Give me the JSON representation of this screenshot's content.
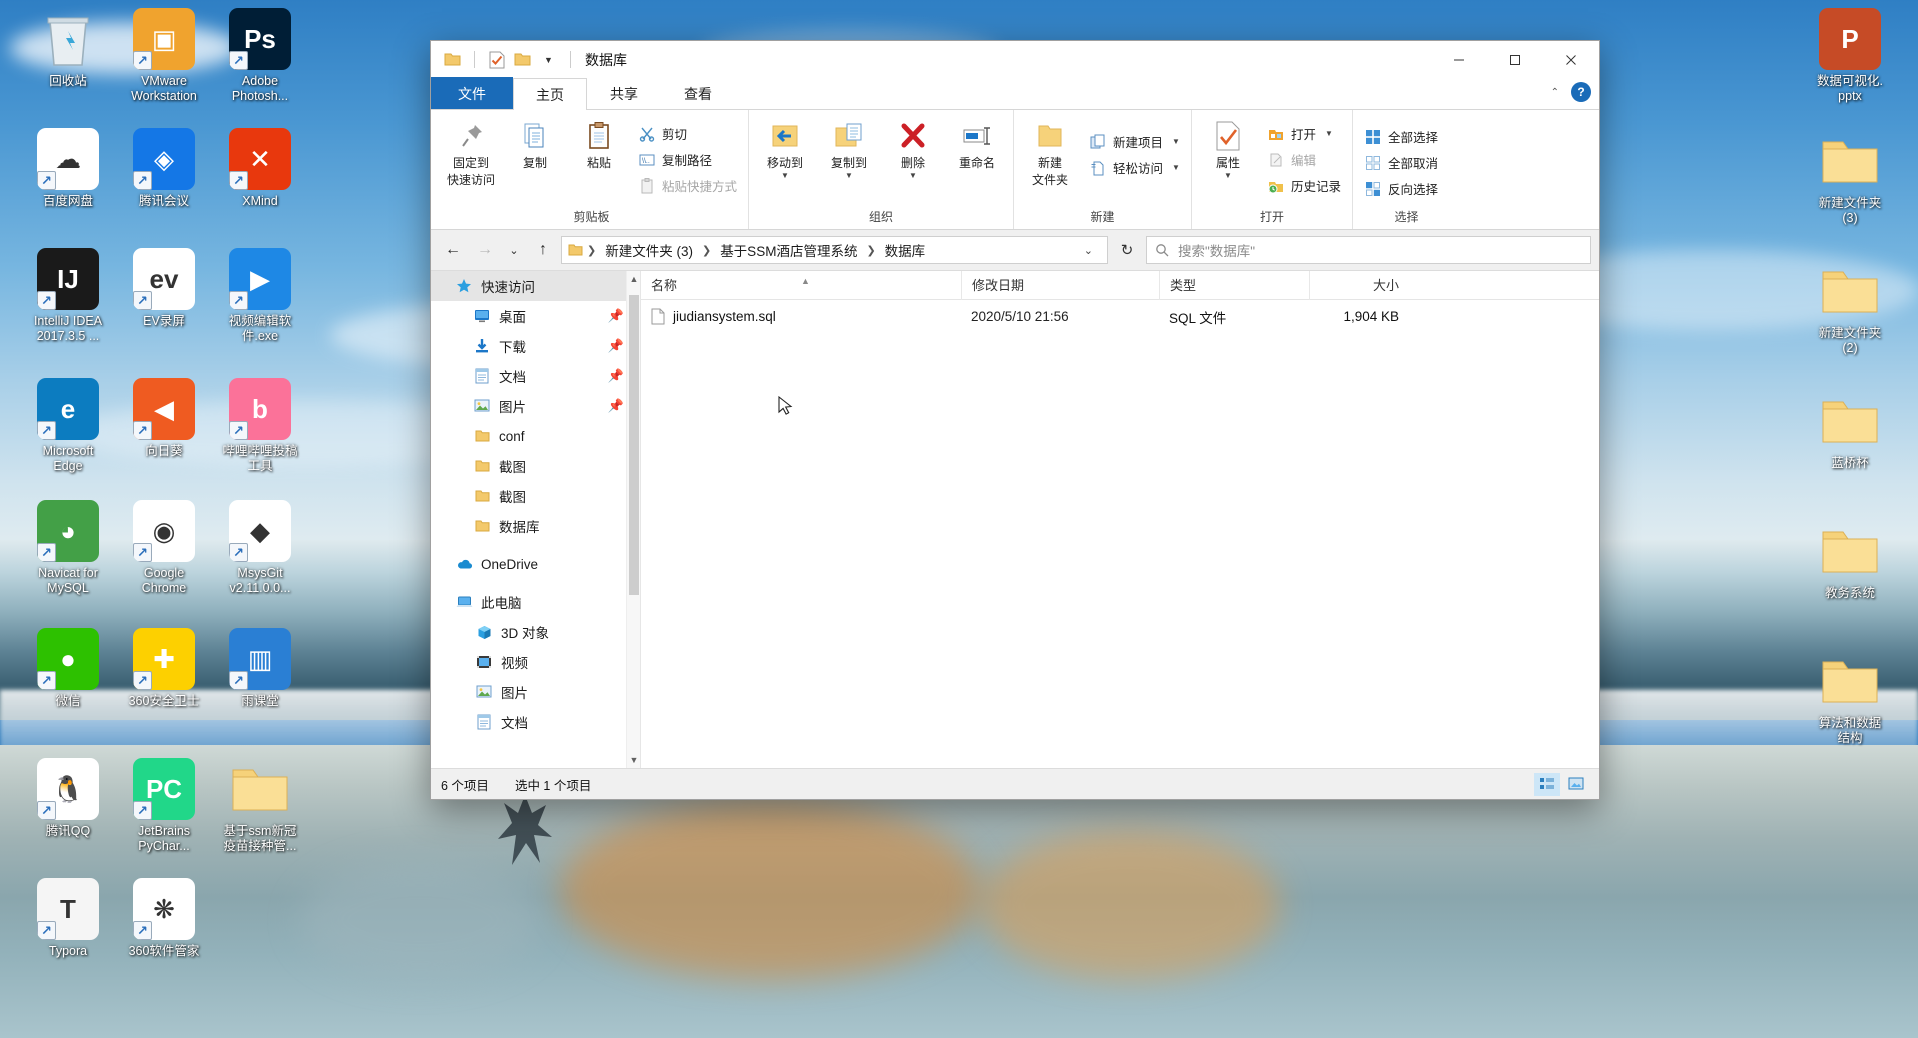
{
  "window": {
    "title": "数据库",
    "quick_access_icons": [
      "folder-icon",
      "properties-check-icon",
      "new-folder-icon",
      "chevron-down-icon"
    ],
    "controls": {
      "minimize": "—",
      "maximize": "▢",
      "close": "✕"
    }
  },
  "ribbon": {
    "tabs": [
      {
        "label": "文件",
        "name": "tab-file"
      },
      {
        "label": "主页",
        "name": "tab-home"
      },
      {
        "label": "共享",
        "name": "tab-share"
      },
      {
        "label": "查看",
        "name": "tab-view"
      }
    ],
    "active_tab": "主页",
    "collapse_icon": "chevron-up-icon",
    "help_icon": "?",
    "groups": [
      {
        "label": "剪贴板",
        "big_buttons": [
          {
            "label": "固定到\n快速访问",
            "line1": "固定到",
            "line2": "快速访问",
            "icon": "pin-icon"
          },
          {
            "label": "复制",
            "line1": "复制",
            "line2": "",
            "icon": "copy-icon"
          },
          {
            "label": "粘贴",
            "line1": "粘贴",
            "line2": "",
            "icon": "paste-icon"
          }
        ],
        "small_buttons": [
          {
            "label": "剪切",
            "icon": "scissors-icon",
            "disabled": false
          },
          {
            "label": "复制路径",
            "icon": "copy-path-icon",
            "disabled": false
          },
          {
            "label": "粘贴快捷方式",
            "icon": "paste-shortcut-icon",
            "disabled": true
          }
        ]
      },
      {
        "label": "组织",
        "big_buttons": [
          {
            "label": "移动到",
            "line1": "移动到",
            "line2": "",
            "icon": "move-to-icon",
            "has_caret": true
          },
          {
            "label": "复制到",
            "line1": "复制到",
            "line2": "",
            "icon": "copy-to-icon",
            "has_caret": true
          },
          {
            "label": "删除",
            "line1": "删除",
            "line2": "",
            "icon": "delete-x-icon",
            "has_caret": true
          },
          {
            "label": "重命名",
            "line1": "重命名",
            "line2": "",
            "icon": "rename-icon",
            "has_caret": false
          }
        ],
        "small_buttons": []
      },
      {
        "label": "新建",
        "big_buttons": [
          {
            "label": "新建\n文件夹",
            "line1": "新建",
            "line2": "文件夹",
            "icon": "new-folder-icon"
          }
        ],
        "small_buttons": [
          {
            "label": "新建项目",
            "icon": "new-item-icon",
            "caret": true
          },
          {
            "label": "轻松访问",
            "icon": "easy-access-icon",
            "caret": true
          }
        ]
      },
      {
        "label": "打开",
        "big_buttons": [
          {
            "label": "属性",
            "line1": "属性",
            "line2": "",
            "icon": "properties-check-icon",
            "has_caret": true
          }
        ],
        "small_buttons": [
          {
            "label": "打开",
            "icon": "open-folder-icon",
            "caret": true
          },
          {
            "label": "编辑",
            "icon": "edit-icon",
            "disabled": true
          },
          {
            "label": "历史记录",
            "icon": "history-icon"
          }
        ]
      },
      {
        "label": "选择",
        "big_buttons": [],
        "small_buttons": [
          {
            "label": "全部选择",
            "icon": "select-all-icon"
          },
          {
            "label": "全部取消",
            "icon": "select-none-icon"
          },
          {
            "label": "反向选择",
            "icon": "invert-selection-icon"
          }
        ]
      }
    ]
  },
  "addressbar": {
    "back_icon": "arrow-left-icon",
    "forward_icon": "arrow-right-icon",
    "recent_icon": "chevron-down-icon",
    "up_icon": "arrow-up-icon",
    "breadcrumb_icon": "folder-icon",
    "breadcrumbs": [
      "新建文件夹 (3)",
      "基于SSM酒店管理系统",
      "数据库"
    ],
    "dropdown_icon": "chevron-down-icon",
    "refresh_icon": "refresh-icon",
    "search": {
      "placeholder": "搜索\"数据库\"",
      "icon": "search-icon"
    }
  },
  "navpane": {
    "sections": [
      {
        "label": "快速访问",
        "icon": "star-pin-icon",
        "selected": true,
        "children": [
          {
            "label": "桌面",
            "icon": "desktop-icon",
            "pinned": true
          },
          {
            "label": "下载",
            "icon": "download-icon",
            "pinned": true
          },
          {
            "label": "文档",
            "icon": "documents-icon",
            "pinned": true
          },
          {
            "label": "图片",
            "icon": "pictures-icon",
            "pinned": true
          },
          {
            "label": "conf",
            "icon": "folder-icon",
            "pinned": false
          },
          {
            "label": "截图",
            "icon": "folder-icon",
            "pinned": false
          },
          {
            "label": "截图",
            "icon": "folder-icon",
            "pinned": false
          },
          {
            "label": "数据库",
            "icon": "folder-icon",
            "pinned": false
          }
        ]
      },
      {
        "label": "OneDrive",
        "icon": "onedrive-cloud-icon",
        "selected": false,
        "children": []
      },
      {
        "label": "此电脑",
        "icon": "this-pc-icon",
        "selected": false,
        "children": [
          {
            "label": "3D 对象",
            "icon": "3d-objects-icon",
            "pinned": false
          },
          {
            "label": "视频",
            "icon": "videos-icon",
            "pinned": false
          },
          {
            "label": "图片",
            "icon": "pictures-icon",
            "pinned": false
          },
          {
            "label": "文档",
            "icon": "documents-icon",
            "pinned": false
          }
        ]
      }
    ]
  },
  "filelist": {
    "columns": [
      {
        "label": "名称",
        "key": "name",
        "sorted": true,
        "sort_dir": "asc"
      },
      {
        "label": "修改日期",
        "key": "date",
        "sorted": false
      },
      {
        "label": "类型",
        "key": "type",
        "sorted": false
      },
      {
        "label": "大小",
        "key": "size",
        "sorted": false
      }
    ],
    "rows": [
      {
        "name": "jiudiansystem.sql",
        "date": "2020/5/10 21:56",
        "type": "SQL 文件",
        "size": "1,904 KB",
        "icon": "file-icon"
      }
    ]
  },
  "statusbar": {
    "item_count": "6 个项目",
    "selection": "选中 1 个项目",
    "view_details_icon": "details-view-icon",
    "view_tiles_icon": "large-icons-view-icon",
    "active_view": "details"
  },
  "desktop": {
    "icons": [
      {
        "label": "回收站",
        "icon": "recycle-bin-icon",
        "shortcut": false,
        "color": "#d9e4ec"
      },
      {
        "label": "VMware\nWorkstation",
        "icon": "vmware-icon",
        "shortcut": true,
        "color": "#f0a32e"
      },
      {
        "label": "Adobe\nPhotosh...",
        "icon": "photoshop-icon",
        "shortcut": true,
        "color": "#001e36"
      },
      {
        "label": "百度网盘",
        "icon": "baidu-netdisk-icon",
        "shortcut": true,
        "color": "#ffffff"
      },
      {
        "label": "腾讯会议",
        "icon": "tencent-meeting-icon",
        "shortcut": true,
        "color": "#1477e6"
      },
      {
        "label": "XMind",
        "icon": "xmind-icon",
        "shortcut": true,
        "color": "#e8380d"
      },
      {
        "label": "IntelliJ IDEA\n2017.3.5 ...",
        "icon": "intellij-idea-icon",
        "shortcut": true,
        "color": "#1a1a1a"
      },
      {
        "label": "EV录屏",
        "icon": "ev-recorder-icon",
        "shortcut": true,
        "color": "#ffffff"
      },
      {
        "label": "视频编辑软\n件.exe",
        "icon": "video-editor-icon",
        "shortcut": true,
        "color": "#1e88e5"
      },
      {
        "label": "Microsoft\nEdge",
        "icon": "edge-icon",
        "shortcut": true,
        "color": "#0c7cc0"
      },
      {
        "label": "向日葵",
        "icon": "sunlogin-icon",
        "shortcut": true,
        "color": "#ef5b21"
      },
      {
        "label": "哔哩哔哩投稿\n工具",
        "icon": "bilibili-icon",
        "shortcut": true,
        "color": "#fb7299"
      },
      {
        "label": "Navicat for\nMySQL",
        "icon": "navicat-icon",
        "shortcut": true,
        "color": "#43a047"
      },
      {
        "label": "Google\nChrome",
        "icon": "chrome-icon",
        "shortcut": true,
        "color": "#ffffff"
      },
      {
        "label": "MsysGit\nv2.11.0.0...",
        "icon": "msysgit-icon",
        "shortcut": true,
        "color": "#ffffff"
      },
      {
        "label": "微信",
        "icon": "wechat-icon",
        "shortcut": true,
        "color": "#2dc100"
      },
      {
        "label": "360安全卫士",
        "icon": "360-safe-icon",
        "shortcut": true,
        "color": "#fdd000"
      },
      {
        "label": "雨课堂",
        "icon": "rain-classroom-icon",
        "shortcut": true,
        "color": "#2a7fd4"
      },
      {
        "label": "腾讯QQ",
        "icon": "qq-icon",
        "shortcut": true,
        "color": "#ffffff"
      },
      {
        "label": "JetBrains\nPyChar...",
        "icon": "pycharm-icon",
        "shortcut": true,
        "color": "#21d789"
      },
      {
        "label": "基于ssm新冠\n疫苗接种管...",
        "icon": "folder-icon",
        "shortcut": false,
        "color": "#f6d27a"
      },
      {
        "label": "Typora",
        "icon": "typora-icon",
        "shortcut": true,
        "color": "#f5f5f5"
      },
      {
        "label": "360软件管家",
        "icon": "360-software-icon",
        "shortcut": true,
        "color": "#ffffff"
      }
    ],
    "right_icons": [
      {
        "label": "数据可视化.\npptx",
        "icon": "powerpoint-icon",
        "shortcut": false
      },
      {
        "label": "新建文件夹\n(3)",
        "icon": "folder-icon",
        "shortcut": false
      },
      {
        "label": "新建文件夹\n(2)",
        "icon": "folder-icon",
        "shortcut": false
      },
      {
        "label": "蓝桥杯",
        "icon": "folder-icon",
        "shortcut": false
      },
      {
        "label": "教务系统",
        "icon": "folder-icon",
        "shortcut": false
      },
      {
        "label": "算法和数据\n结构",
        "icon": "folder-icon",
        "shortcut": false
      }
    ]
  },
  "colors": {
    "accent": "#1a6bb8",
    "folder": "#f6d27a",
    "selection": "#cde6f7",
    "close_hover": "#e81123"
  }
}
